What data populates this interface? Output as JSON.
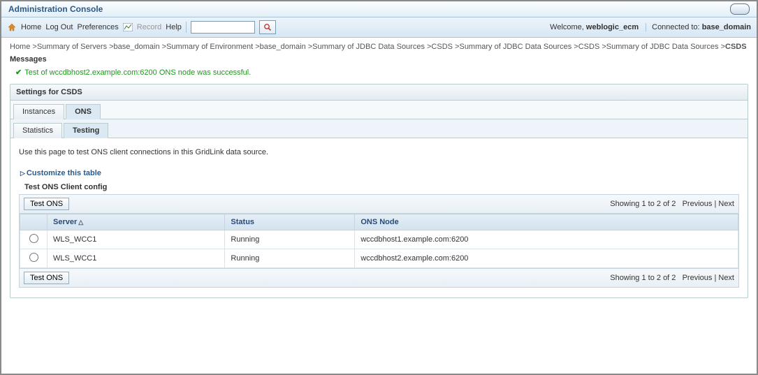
{
  "header": {
    "title": "Administration Console"
  },
  "toolbar": {
    "home": "Home",
    "logout": "Log Out",
    "preferences": "Preferences",
    "record": "Record",
    "help": "Help",
    "search_value": "",
    "welcome_prefix": "Welcome, ",
    "welcome_user": "weblogic_ecm",
    "connected_prefix": "Connected to: ",
    "connected_domain": "base_domain"
  },
  "breadcrumb": "Home >Summary of Servers >base_domain >Summary of Environment >base_domain >Summary of JDBC Data Sources >CSDS >Summary of JDBC Data Sources >CSDS >Summary of JDBC Data Sources >",
  "breadcrumb_current": "CSDS",
  "messages": {
    "label": "Messages",
    "success": "Test of wccdbhost2.example.com:6200 ONS node was successful."
  },
  "panel": {
    "title": "Settings for CSDS",
    "tabs": {
      "instances": "Instances",
      "ons": "ONS"
    },
    "subtabs": {
      "statistics": "Statistics",
      "testing": "Testing"
    },
    "description": "Use this page to test ONS client connections in this GridLink data source.",
    "customize": "Customize this table",
    "table_title": "Test ONS Client config",
    "test_btn": "Test ONS",
    "pager": {
      "showing": "Showing 1 to 2 of 2",
      "previous": "Previous",
      "next": "Next"
    },
    "columns": {
      "server": "Server",
      "status": "Status",
      "ons_node": "ONS Node"
    },
    "rows": [
      {
        "server": "WLS_WCC1",
        "status": "Running",
        "ons_node": "wccdbhost1.example.com:6200"
      },
      {
        "server": "WLS_WCC1",
        "status": "Running",
        "ons_node": "wccdbhost2.example.com:6200"
      }
    ]
  }
}
